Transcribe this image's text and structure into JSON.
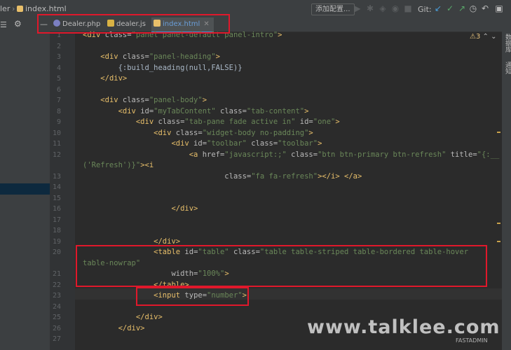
{
  "breadcrumb": {
    "left_part": "ler",
    "separator": "›",
    "file": "index.html"
  },
  "toolbar": {
    "add_config": "添加配置...",
    "git_label": "Git:"
  },
  "tabs": [
    {
      "label": "Dealer.php",
      "active": false
    },
    {
      "label": "dealer.js",
      "active": false
    },
    {
      "label": "index.html",
      "active": true
    }
  ],
  "editor": {
    "warning_count": "3"
  },
  "right_tool_windows": [
    "数据库",
    "通知"
  ],
  "lines": [
    {
      "n": "1",
      "parts": [
        [
          "t",
          "<div "
        ],
        [
          "a",
          "class="
        ],
        [
          "s",
          "\"panel panel-default panel-intro\""
        ],
        [
          "t",
          ">"
        ]
      ]
    },
    {
      "n": "2",
      "parts": []
    },
    {
      "n": "3",
      "parts": [
        [
          "p",
          "    "
        ],
        [
          "t",
          "<div "
        ],
        [
          "a",
          "class="
        ],
        [
          "s",
          "\"panel-heading\""
        ],
        [
          "t",
          ">"
        ]
      ]
    },
    {
      "n": "4",
      "parts": [
        [
          "p",
          "        {:build_heading(null,FALSE)}"
        ]
      ]
    },
    {
      "n": "5",
      "parts": [
        [
          "p",
          "    "
        ],
        [
          "t",
          "</div>"
        ]
      ]
    },
    {
      "n": "6",
      "parts": []
    },
    {
      "n": "7",
      "parts": [
        [
          "p",
          "    "
        ],
        [
          "t",
          "<div "
        ],
        [
          "a",
          "class="
        ],
        [
          "s",
          "\"panel-body\""
        ],
        [
          "t",
          ">"
        ]
      ]
    },
    {
      "n": "8",
      "parts": [
        [
          "p",
          "        "
        ],
        [
          "t",
          "<div "
        ],
        [
          "a",
          "id="
        ],
        [
          "s",
          "\"myTabContent\" "
        ],
        [
          "a",
          "class="
        ],
        [
          "s",
          "\"tab-content\""
        ],
        [
          "t",
          ">"
        ]
      ]
    },
    {
      "n": "9",
      "parts": [
        [
          "p",
          "            "
        ],
        [
          "t",
          "<div "
        ],
        [
          "a",
          "class="
        ],
        [
          "s",
          "\"tab-pane fade active in\" "
        ],
        [
          "a",
          "id="
        ],
        [
          "s",
          "\"one\""
        ],
        [
          "t",
          ">"
        ]
      ]
    },
    {
      "n": "10",
      "parts": [
        [
          "p",
          "                "
        ],
        [
          "t",
          "<div "
        ],
        [
          "a",
          "class="
        ],
        [
          "s",
          "\"widget-body no-padding\""
        ],
        [
          "t",
          ">"
        ]
      ]
    },
    {
      "n": "11",
      "parts": [
        [
          "p",
          "                    "
        ],
        [
          "t",
          "<div "
        ],
        [
          "a",
          "id="
        ],
        [
          "s",
          "\"toolbar\" "
        ],
        [
          "a",
          "class="
        ],
        [
          "s",
          "\"toolbar\""
        ],
        [
          "t",
          ">"
        ]
      ]
    },
    {
      "n": "12",
      "parts": [
        [
          "p",
          "                        "
        ],
        [
          "t",
          "<a "
        ],
        [
          "a",
          "href="
        ],
        [
          "s",
          "\"javascript:;\" "
        ],
        [
          "a",
          "class="
        ],
        [
          "s",
          "\"btn btn-primary btn-refresh\" "
        ],
        [
          "a",
          "title="
        ],
        [
          "s",
          "\"{:__"
        ]
      ]
    },
    {
      "n": "",
      "parts": [
        [
          "s",
          "('Refresh')}\""
        ],
        [
          "t",
          ">"
        ],
        [
          "t",
          "<i"
        ]
      ]
    },
    {
      "n": "13",
      "parts": [
        [
          "p",
          "                                "
        ],
        [
          "a",
          "class="
        ],
        [
          "s",
          "\"fa fa-refresh\""
        ],
        [
          "t",
          "></i> </a>"
        ]
      ]
    },
    {
      "n": "14",
      "parts": []
    },
    {
      "n": "15",
      "parts": []
    },
    {
      "n": "16",
      "parts": [
        [
          "p",
          "                    "
        ],
        [
          "t",
          "</div>"
        ]
      ]
    },
    {
      "n": "17",
      "parts": []
    },
    {
      "n": "18",
      "parts": []
    },
    {
      "n": "19",
      "parts": [
        [
          "p",
          "                "
        ],
        [
          "t",
          "</div>"
        ]
      ]
    },
    {
      "n": "20",
      "parts": [
        [
          "p",
          "                "
        ],
        [
          "t",
          "<table "
        ],
        [
          "a",
          "id="
        ],
        [
          "s",
          "\"table\" "
        ],
        [
          "a",
          "class="
        ],
        [
          "s",
          "\"table table-striped table-bordered table-hover"
        ]
      ]
    },
    {
      "n": "",
      "parts": [
        [
          "s",
          "table-nowrap\""
        ]
      ]
    },
    {
      "n": "21",
      "parts": [
        [
          "p",
          "                    "
        ],
        [
          "a",
          "width="
        ],
        [
          "s",
          "\"100%\""
        ],
        [
          "t",
          ">"
        ]
      ]
    },
    {
      "n": "22",
      "parts": [
        [
          "p",
          "                "
        ],
        [
          "t",
          "</table>"
        ]
      ]
    },
    {
      "n": "23",
      "parts": [
        [
          "p",
          "                "
        ],
        [
          "t",
          "<input "
        ],
        [
          "a",
          "type="
        ],
        [
          "s",
          "\"number\""
        ],
        [
          "t",
          ">"
        ]
      ]
    },
    {
      "n": "24",
      "parts": []
    },
    {
      "n": "25",
      "parts": [
        [
          "p",
          "            "
        ],
        [
          "t",
          "</div>"
        ]
      ]
    },
    {
      "n": "26",
      "parts": [
        [
          "p",
          "        "
        ],
        [
          "t",
          "</div>"
        ]
      ]
    },
    {
      "n": "27",
      "parts": []
    }
  ],
  "watermark": {
    "text": "www.talklee.com",
    "sub": "FASTADMIN"
  },
  "colors": {
    "accent": "#4a88c7",
    "annotation_red": "#e0182b",
    "tag": "#e8bf6a",
    "string": "#6a8759"
  }
}
